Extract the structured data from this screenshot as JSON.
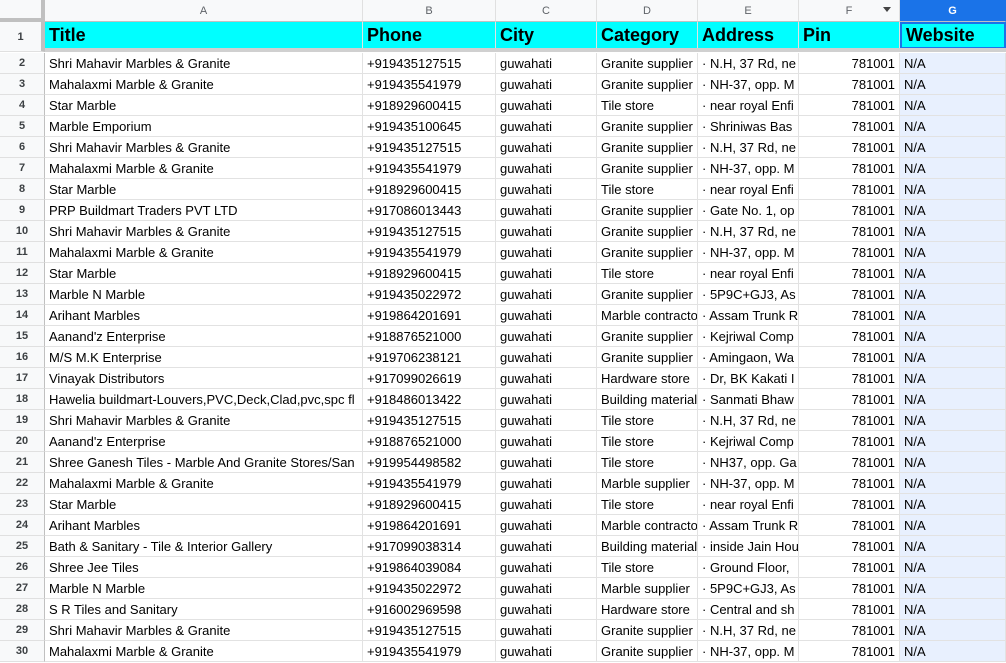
{
  "column_letters": [
    "A",
    "B",
    "C",
    "D",
    "E",
    "F",
    "G"
  ],
  "headers": [
    "Title",
    "Phone",
    "City",
    "Category",
    "Address",
    "Pin",
    "Website"
  ],
  "rows": [
    {
      "n": "2",
      "title": "Shri Mahavir Marbles & Granite",
      "phone": "+919435127515",
      "city": "guwahati",
      "category": "Granite supplier",
      "address": "· N.H, 37 Rd, ne",
      "pin": "781001",
      "website": "N/A"
    },
    {
      "n": "3",
      "title": "Mahalaxmi Marble & Granite",
      "phone": "+919435541979",
      "city": "guwahati",
      "category": "Granite supplier",
      "address": "· NH-37, opp. M",
      "pin": "781001",
      "website": "N/A"
    },
    {
      "n": "4",
      "title": "Star Marble",
      "phone": "+918929600415",
      "city": "guwahati",
      "category": "Tile store",
      "address": "· near royal Enfi",
      "pin": "781001",
      "website": "N/A"
    },
    {
      "n": "5",
      "title": "Marble Emporium",
      "phone": "+919435100645",
      "city": "guwahati",
      "category": "Granite supplier",
      "address": "· Shriniwas Bas",
      "pin": "781001",
      "website": "N/A"
    },
    {
      "n": "6",
      "title": "Shri Mahavir Marbles & Granite",
      "phone": "+919435127515",
      "city": "guwahati",
      "category": "Granite supplier",
      "address": "· N.H, 37 Rd, ne",
      "pin": "781001",
      "website": "N/A"
    },
    {
      "n": "7",
      "title": "Mahalaxmi Marble & Granite",
      "phone": "+919435541979",
      "city": "guwahati",
      "category": "Granite supplier",
      "address": "· NH-37, opp. M",
      "pin": "781001",
      "website": "N/A"
    },
    {
      "n": "8",
      "title": "Star Marble",
      "phone": "+918929600415",
      "city": "guwahati",
      "category": "Tile store",
      "address": "· near royal Enfi",
      "pin": "781001",
      "website": "N/A"
    },
    {
      "n": "9",
      "title": "PRP Buildmart Traders PVT LTD",
      "phone": "+917086013443",
      "city": "guwahati",
      "category": "Granite supplier",
      "address": "· Gate No. 1, op",
      "pin": "781001",
      "website": "N/A"
    },
    {
      "n": "10",
      "title": "Shri Mahavir Marbles & Granite",
      "phone": "+919435127515",
      "city": "guwahati",
      "category": "Granite supplier",
      "address": "· N.H, 37 Rd, ne",
      "pin": "781001",
      "website": "N/A"
    },
    {
      "n": "11",
      "title": "Mahalaxmi Marble & Granite",
      "phone": "+919435541979",
      "city": "guwahati",
      "category": "Granite supplier",
      "address": "· NH-37, opp. M",
      "pin": "781001",
      "website": "N/A"
    },
    {
      "n": "12",
      "title": "Star Marble",
      "phone": "+918929600415",
      "city": "guwahati",
      "category": "Tile store",
      "address": "· near royal Enfi",
      "pin": "781001",
      "website": "N/A"
    },
    {
      "n": "13",
      "title": "Marble N Marble",
      "phone": "+919435022972",
      "city": "guwahati",
      "category": "Granite supplier",
      "address": "· 5P9C+GJ3, As",
      "pin": "781001",
      "website": "N/A"
    },
    {
      "n": "14",
      "title": "Arihant Marbles",
      "phone": "+919864201691",
      "city": "guwahati",
      "category": "Marble contractor",
      "address": "· Assam Trunk R",
      "pin": "781001",
      "website": "N/A"
    },
    {
      "n": "15",
      "title": "Aanand'z Enterprise",
      "phone": "+918876521000",
      "city": "guwahati",
      "category": "Granite supplier",
      "address": "· Kejriwal Comp",
      "pin": "781001",
      "website": "N/A"
    },
    {
      "n": "16",
      "title": "M/S M.K Enterprise",
      "phone": "+919706238121",
      "city": "guwahati",
      "category": "Granite supplier",
      "address": "· Amingaon, Wa",
      "pin": "781001",
      "website": "N/A"
    },
    {
      "n": "17",
      "title": "Vinayak Distributors",
      "phone": "+917099026619",
      "city": "guwahati",
      "category": "Hardware store",
      "address": "· Dr, BK Kakati I",
      "pin": "781001",
      "website": "N/A"
    },
    {
      "n": "18",
      "title": "Hawelia buildmart-Louvers,PVC,Deck,Clad,pvc,spc fl",
      "phone": "+918486013422",
      "city": "guwahati",
      "category": "Building material",
      "address": "· Sanmati Bhaw",
      "pin": "781001",
      "website": "N/A"
    },
    {
      "n": "19",
      "title": "Shri Mahavir Marbles & Granite",
      "phone": "+919435127515",
      "city": "guwahati",
      "category": "Tile store",
      "address": "· N.H, 37 Rd, ne",
      "pin": "781001",
      "website": "N/A"
    },
    {
      "n": "20",
      "title": "Aanand'z Enterprise",
      "phone": "+918876521000",
      "city": "guwahati",
      "category": "Tile store",
      "address": "· Kejriwal Comp",
      "pin": "781001",
      "website": "N/A"
    },
    {
      "n": "21",
      "title": "Shree Ganesh Tiles - Marble And Granite Stores/San",
      "phone": "+919954498582",
      "city": "guwahati",
      "category": "Tile store",
      "address": "· NH37, opp. Ga",
      "pin": "781001",
      "website": "N/A"
    },
    {
      "n": "22",
      "title": "Mahalaxmi Marble & Granite",
      "phone": "+919435541979",
      "city": "guwahati",
      "category": "Marble supplier",
      "address": "· NH-37, opp. M",
      "pin": "781001",
      "website": "N/A"
    },
    {
      "n": "23",
      "title": "Star Marble",
      "phone": "+918929600415",
      "city": "guwahati",
      "category": "Tile store",
      "address": "· near royal Enfi",
      "pin": "781001",
      "website": "N/A"
    },
    {
      "n": "24",
      "title": "Arihant Marbles",
      "phone": "+919864201691",
      "city": "guwahati",
      "category": "Marble contractor",
      "address": "· Assam Trunk R",
      "pin": "781001",
      "website": "N/A"
    },
    {
      "n": "25",
      "title": "Bath & Sanitary - Tile & Interior Gallery",
      "phone": "+917099038314",
      "city": "guwahati",
      "category": "Building material",
      "address": "· inside Jain Hou",
      "pin": "781001",
      "website": "N/A"
    },
    {
      "n": "26",
      "title": "Shree Jee Tiles",
      "phone": "+919864039084",
      "city": "guwahati",
      "category": "Tile store",
      "address": "· Ground Floor,",
      "pin": "781001",
      "website": "N/A"
    },
    {
      "n": "27",
      "title": "Marble N Marble",
      "phone": "+919435022972",
      "city": "guwahati",
      "category": "Marble supplier",
      "address": "· 5P9C+GJ3, As",
      "pin": "781001",
      "website": "N/A"
    },
    {
      "n": "28",
      "title": "S R Tiles and Sanitary",
      "phone": "+916002969598",
      "city": "guwahati",
      "category": "Hardware store",
      "address": "· Central and sh",
      "pin": "781001",
      "website": "N/A"
    },
    {
      "n": "29",
      "title": "Shri Mahavir Marbles & Granite",
      "phone": "+919435127515",
      "city": "guwahati",
      "category": "Granite supplier",
      "address": "· N.H, 37 Rd, ne",
      "pin": "781001",
      "website": "N/A"
    },
    {
      "n": "30",
      "title": "Mahalaxmi Marble & Granite",
      "phone": "+919435541979",
      "city": "guwahati",
      "category": "Granite supplier",
      "address": "· NH-37, opp. M",
      "pin": "781001",
      "website": "N/A"
    }
  ]
}
